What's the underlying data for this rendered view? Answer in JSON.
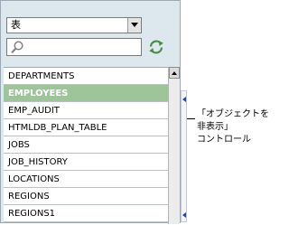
{
  "object_type_select": {
    "selected": "表"
  },
  "search": {
    "value": "",
    "placeholder": ""
  },
  "objects": [
    {
      "name": "DEPARTMENTS",
      "selected": false
    },
    {
      "name": "EMPLOYEES",
      "selected": true
    },
    {
      "name": "EMP_AUDIT",
      "selected": false
    },
    {
      "name": "HTMLDB_PLAN_TABLE",
      "selected": false
    },
    {
      "name": "JOBS",
      "selected": false
    },
    {
      "name": "JOB_HISTORY",
      "selected": false
    },
    {
      "name": "LOCATIONS",
      "selected": false
    },
    {
      "name": "REGIONS",
      "selected": false
    },
    {
      "name": "REGIONS1",
      "selected": false
    }
  ],
  "callout": {
    "line1": "「オブジェクトを",
    "line2": "非表示」",
    "line3": "コントロール"
  },
  "colors": {
    "selected_row": "#9ec49a",
    "panel_bg": "#dde7ee",
    "splitter_arrow": "#1f3fb8"
  }
}
